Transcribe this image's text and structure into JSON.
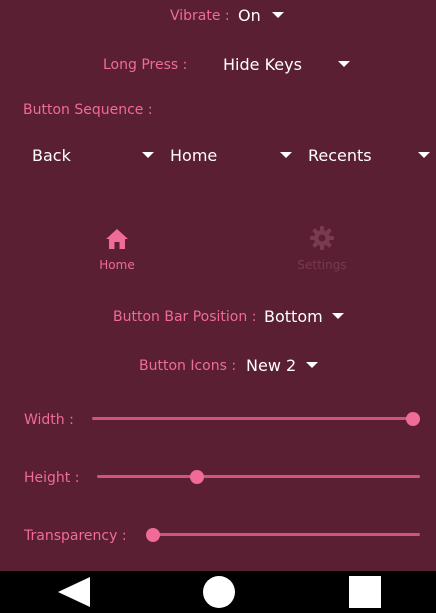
{
  "settings": {
    "vibrate": {
      "label": "Vibrate :",
      "value": "On"
    },
    "long_press": {
      "label": "Long Press :",
      "value": "Hide Keys"
    },
    "button_sequence": {
      "label": "Button Sequence :",
      "slots": [
        "Back",
        "Home",
        "Recents"
      ]
    }
  },
  "tabs": [
    {
      "label": "Home",
      "icon": "home-icon",
      "active": true
    },
    {
      "label": "Settings",
      "icon": "gear-icon",
      "active": false
    }
  ],
  "home": {
    "button_bar_position": {
      "label": "Button Bar Position :",
      "value": "Bottom"
    },
    "button_icons": {
      "label": "Button Icons :",
      "value": "New 2"
    },
    "sliders": [
      {
        "label": "Width :",
        "level": 1.0
      },
      {
        "label": "Height :",
        "level": 0.3
      },
      {
        "label": "Transparency :",
        "level": 0.0
      }
    ]
  },
  "navbar": {
    "buttons": [
      "back-icon",
      "home-circle-icon",
      "recents-square-icon"
    ]
  },
  "colors": {
    "background": "#5a1f33",
    "accent": "#f06b98",
    "slider_track": "#d1547d",
    "navbar": "#000000",
    "inactive_tab": "#7a3a52"
  }
}
